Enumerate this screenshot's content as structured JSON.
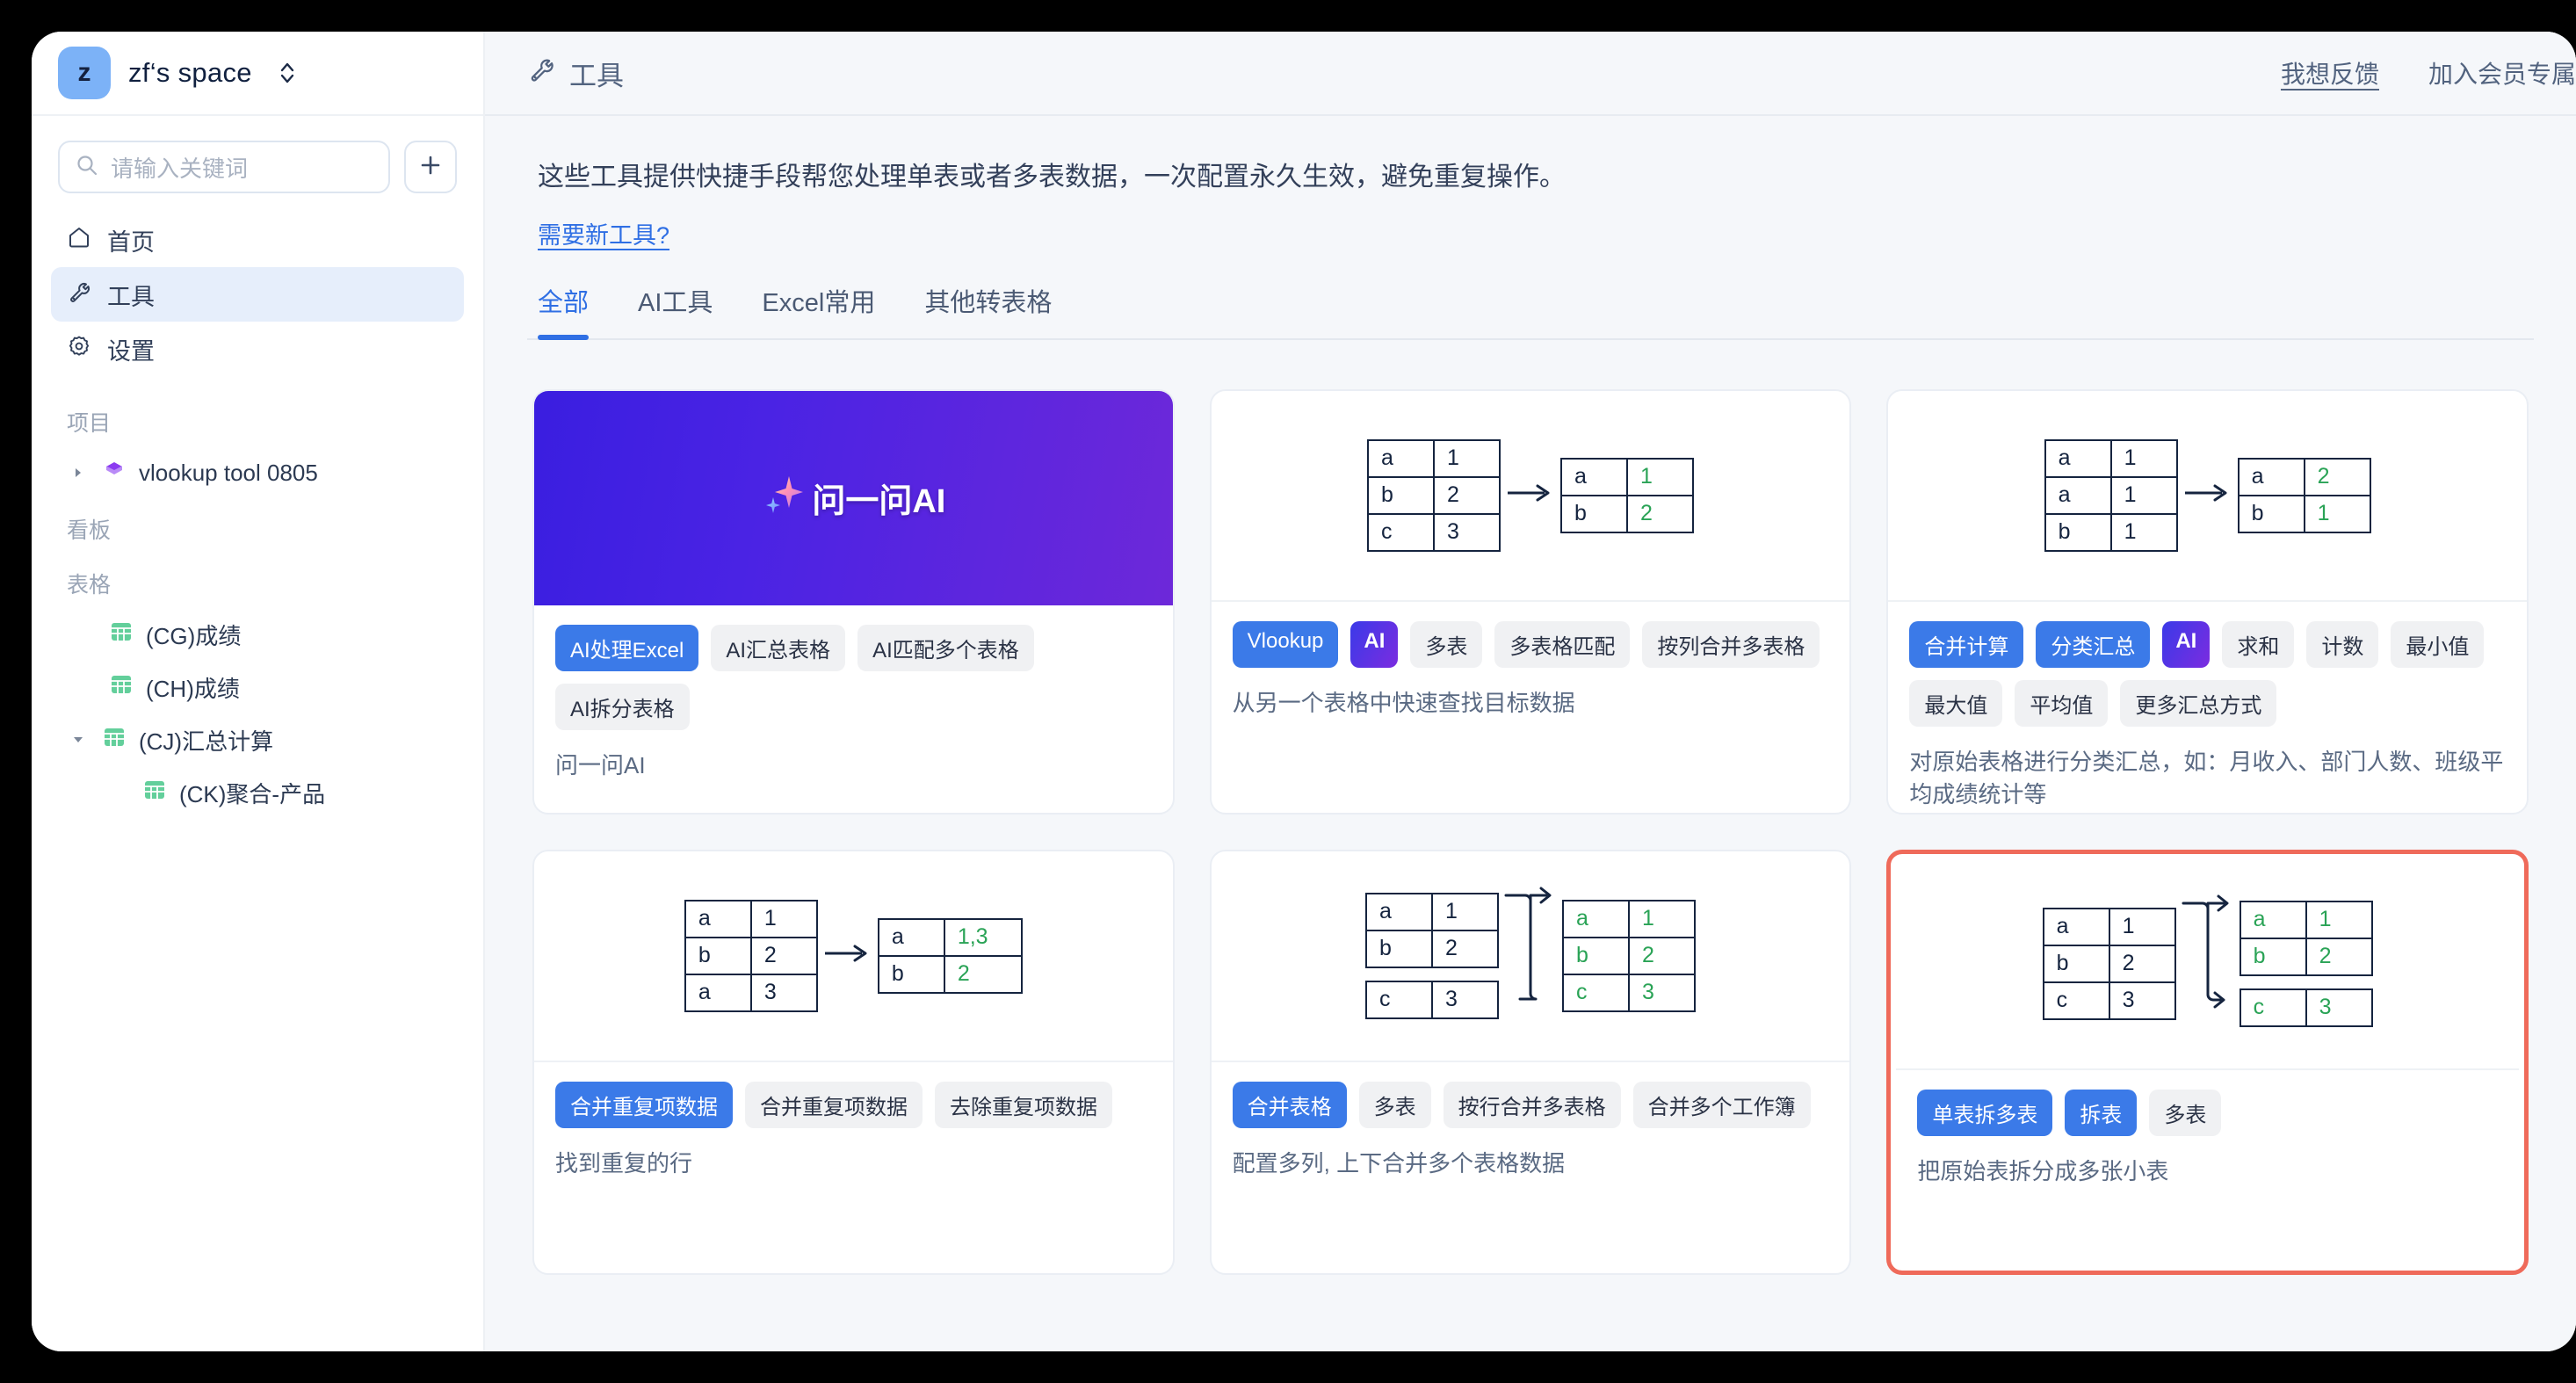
{
  "workspace": {
    "avatar_letter": "z",
    "name": "zf‘s space",
    "switch_icon": "chevron-up-down-icon"
  },
  "search": {
    "placeholder": "请输入关键词",
    "icon": "search-icon",
    "add_icon": "plus-icon"
  },
  "nav": [
    {
      "label": "首页",
      "icon": "home-icon",
      "active": false
    },
    {
      "label": "工具",
      "icon": "wrench-icon",
      "active": true
    },
    {
      "label": "设置",
      "icon": "gear-icon",
      "active": false
    }
  ],
  "tree": {
    "section_project": "项目",
    "project_item": "vlookup tool 0805",
    "section_board": "看板",
    "section_tables": "表格",
    "tables": [
      {
        "label": "(CG)成绩"
      },
      {
        "label": "(CH)成绩"
      },
      {
        "label": "(CJ)汇总计算"
      },
      {
        "label": "(CK)聚合-产品"
      }
    ]
  },
  "topbar": {
    "title": "工具",
    "title_icon": "wrench-icon",
    "feedback_link": "我想反馈",
    "member_link": "加入会员专属"
  },
  "intro": {
    "text": "这些工具提供快捷手段帮您处理单表或者多表数据，一次配置永久生效，避免重复操作。",
    "link": "需要新工具?"
  },
  "tabs": [
    {
      "label": "全部",
      "active": true
    },
    {
      "label": "AI工具",
      "active": false
    },
    {
      "label": "Excel常用",
      "active": false
    },
    {
      "label": "其他转表格",
      "active": false
    }
  ],
  "cards": [
    {
      "id": "ask-ai",
      "hero_title": "问一问AI",
      "hero_icon": "sparkle-icon",
      "figure": "gradient",
      "pills": [
        {
          "label": "AI处理Excel",
          "style": "blue"
        },
        {
          "label": "AI汇总表格",
          "style": "grey"
        },
        {
          "label": "AI匹配多个表格",
          "style": "grey"
        },
        {
          "label": "AI拆分表格",
          "style": "grey"
        }
      ],
      "desc": "问一问AI"
    },
    {
      "id": "vlookup",
      "figure": "table-arrow",
      "source_rows": [
        [
          "a",
          "1"
        ],
        [
          "b",
          "2"
        ],
        [
          "c",
          "3"
        ]
      ],
      "result_rows": [
        [
          "a",
          "1"
        ],
        [
          "b",
          "2"
        ]
      ],
      "pills": [
        {
          "label": "Vlookup",
          "style": "blue"
        },
        {
          "label": "AI",
          "style": "ai"
        },
        {
          "label": "多表",
          "style": "grey"
        },
        {
          "label": "多表格匹配",
          "style": "grey"
        },
        {
          "label": "按列合并多表格",
          "style": "grey"
        }
      ],
      "desc": "从另一个表格中快速查找目标数据"
    },
    {
      "id": "consolidate",
      "figure": "table-arrow",
      "source_rows": [
        [
          "a",
          "1"
        ],
        [
          "a",
          "1"
        ],
        [
          "b",
          "1"
        ]
      ],
      "result_rows": [
        [
          "a",
          "2"
        ],
        [
          "b",
          "1"
        ]
      ],
      "pills": [
        {
          "label": "合并计算",
          "style": "blue"
        },
        {
          "label": "分类汇总",
          "style": "blue"
        },
        {
          "label": "AI",
          "style": "ai"
        },
        {
          "label": "求和",
          "style": "grey"
        },
        {
          "label": "计数",
          "style": "grey"
        },
        {
          "label": "最小值",
          "style": "grey"
        },
        {
          "label": "最大值",
          "style": "grey"
        },
        {
          "label": "平均值",
          "style": "grey"
        },
        {
          "label": "更多汇总方式",
          "style": "grey"
        }
      ],
      "desc": "对原始表格进行分类汇总，如：月收入、部门人数、班级平均成绩统计等"
    },
    {
      "id": "merge-duplicates",
      "figure": "table-arrow",
      "source_rows": [
        [
          "a",
          "1"
        ],
        [
          "b",
          "2"
        ],
        [
          "a",
          "3"
        ]
      ],
      "result_rows": [
        [
          "a",
          "1,3"
        ],
        [
          "b",
          "2"
        ]
      ],
      "pills": [
        {
          "label": "合并重复项数据",
          "style": "blue"
        },
        {
          "label": "合并重复项数据",
          "style": "grey"
        },
        {
          "label": "去除重复项数据",
          "style": "grey"
        }
      ],
      "desc": "找到重复的行"
    },
    {
      "id": "merge-tables",
      "figure": "table-bracket-merge",
      "source_rows_top": [
        [
          "a",
          "1"
        ],
        [
          "b",
          "2"
        ]
      ],
      "source_rows_bottom": [
        [
          "c",
          "3"
        ]
      ],
      "result_rows": [
        [
          "a",
          "1"
        ],
        [
          "b",
          "2"
        ],
        [
          "c",
          "3"
        ]
      ],
      "pills": [
        {
          "label": "合并表格",
          "style": "blue"
        },
        {
          "label": "多表",
          "style": "grey"
        },
        {
          "label": "按行合并多表格",
          "style": "grey"
        },
        {
          "label": "合并多个工作簿",
          "style": "grey"
        }
      ],
      "desc": "配置多列, 上下合并多个表格数据"
    },
    {
      "id": "split-table",
      "figure": "table-bracket-split",
      "selected": true,
      "source_rows": [
        [
          "a",
          "1"
        ],
        [
          "b",
          "2"
        ],
        [
          "c",
          "3"
        ]
      ],
      "result_rows_top": [
        [
          "a",
          "1"
        ],
        [
          "b",
          "2"
        ]
      ],
      "result_rows_bottom": [
        [
          "c",
          "3"
        ]
      ],
      "pills": [
        {
          "label": "单表拆多表",
          "style": "blue"
        },
        {
          "label": "拆表",
          "style": "blue"
        },
        {
          "label": "多表",
          "style": "grey"
        }
      ],
      "desc": "把原始表拆分成多张小表"
    }
  ],
  "colors": {
    "accent_blue": "#3b7ae8",
    "tab_blue": "#2f6fe4",
    "selected_border": "#ef6a5a",
    "table_green": "#2aa356",
    "table_border": "#15243f",
    "avatar_blue": "#7cb2f7"
  }
}
